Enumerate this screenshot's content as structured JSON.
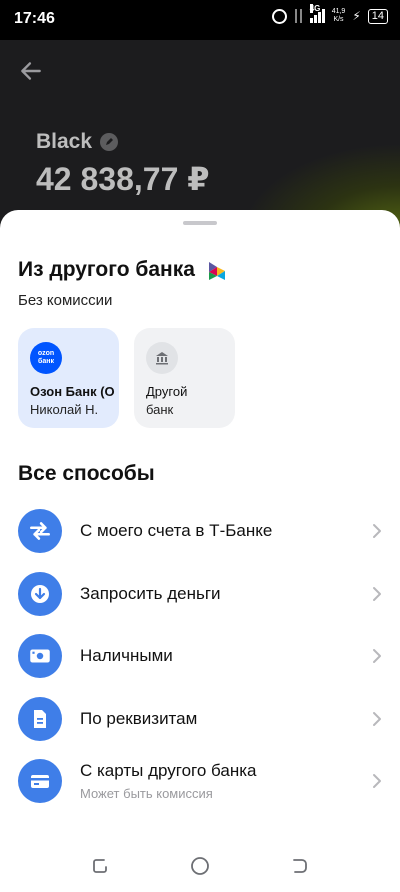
{
  "status_bar": {
    "time": "17:46",
    "network": "4G",
    "speed_value": "41,9",
    "speed_unit": "K/s",
    "battery": "14"
  },
  "header": {
    "account_name": "Black",
    "balance": "42 838,77 ₽"
  },
  "sheet": {
    "title": "Из другого банка",
    "subtitle": "Без комиссии",
    "banks": [
      {
        "line1": "Озон Банк (О",
        "line2": "Николай Н.",
        "logo_text": "ozon банк",
        "icon": "ozon-logo"
      },
      {
        "line1": "Другой",
        "line2": "банк",
        "icon": "bank-building-icon"
      }
    ],
    "section_title": "Все способы",
    "methods": [
      {
        "label": "С моего счета в Т-Банке",
        "icon": "transfer-arrows-icon"
      },
      {
        "label": "Запросить деньги",
        "icon": "download-arrow-icon"
      },
      {
        "label": "Наличными",
        "icon": "cash-icon"
      },
      {
        "label": "По реквизитам",
        "icon": "document-icon"
      },
      {
        "label": "С карты другого банка",
        "sublabel": "Может быть комиссия",
        "icon": "card-icon"
      }
    ]
  },
  "colors": {
    "accent_blue": "#3f7ee8",
    "ozon_blue": "#0055ff",
    "header_bg": "#1c1c1e"
  }
}
